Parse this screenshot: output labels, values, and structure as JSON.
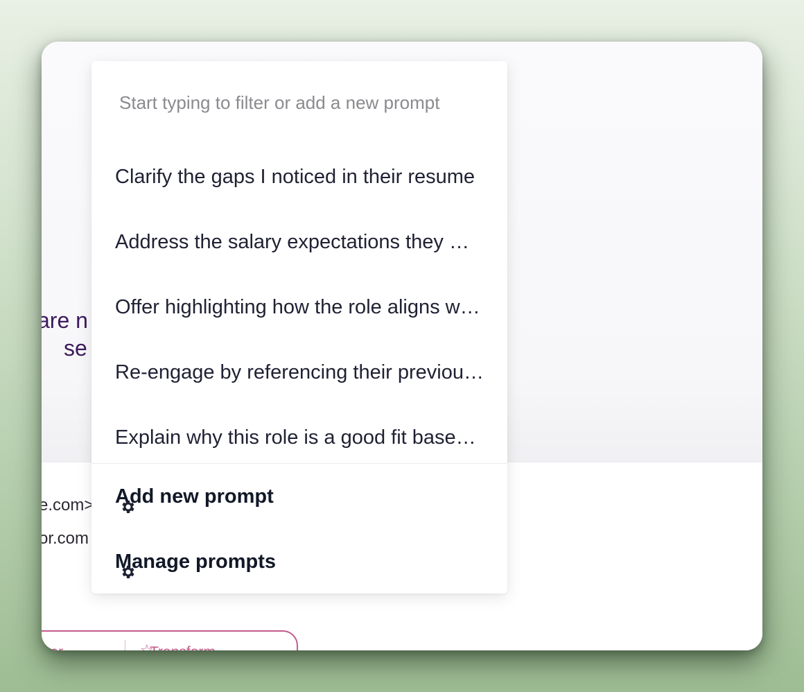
{
  "background": {
    "partial_text_line1": "are n",
    "partial_text_line2": "se",
    "address_line1": "e.com>",
    "address_line2": "or.com"
  },
  "toolbar": {
    "tone_label": "ser",
    "transform_label": "Transform"
  },
  "dropdown": {
    "search_placeholder": "Start typing to filter or add a new prompt",
    "prompts": [
      "Clarify the gaps I noticed in their resume",
      "Address the salary expectations they mentioned",
      "Offer highlighting how the role aligns with their goals",
      "Re-engage by referencing their previous interest",
      "Explain why this role is a good fit based on their background"
    ],
    "actions": {
      "add_label": "Add new prompt",
      "manage_label": "Manage prompts"
    }
  },
  "colors": {
    "accent": "#c25a8a",
    "heading": "#3d1a5e",
    "text": "#1f2133"
  },
  "icons": {
    "add_action": "gear-icon",
    "manage_action": "gear-icon"
  }
}
